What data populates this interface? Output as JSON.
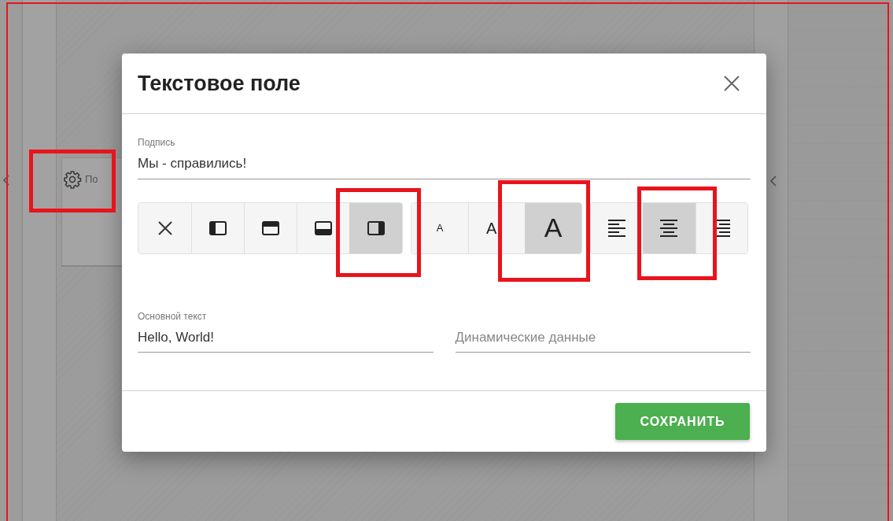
{
  "background": {
    "panel_item": {
      "label": "По"
    }
  },
  "dialog": {
    "title": "Текстовое поле",
    "caption_field": {
      "label": "Подпись",
      "value": "Мы - справились!"
    },
    "toolbar": [
      {
        "kind": "position",
        "buttons": [
          {
            "kind": "none",
            "selected": false
          },
          {
            "kind": "left",
            "selected": false
          },
          {
            "kind": "top",
            "selected": false
          },
          {
            "kind": "bottom",
            "selected": false
          },
          {
            "kind": "right",
            "selected": true
          }
        ]
      },
      {
        "kind": "size",
        "buttons": [
          {
            "kind": "small",
            "label": "A",
            "selected": false
          },
          {
            "kind": "medium",
            "label": "A",
            "selected": false
          },
          {
            "kind": "large",
            "label": "A",
            "selected": true
          }
        ]
      },
      {
        "kind": "align",
        "buttons": [
          {
            "kind": "left",
            "selected": false
          },
          {
            "kind": "center",
            "selected": true
          },
          {
            "kind": "right",
            "selected": false
          }
        ]
      }
    ],
    "main_text_field": {
      "label": "Основной текст",
      "value": "Hello, World!"
    },
    "dynamic_data_field": {
      "placeholder": "Динамические данные"
    },
    "save_button": "СОХРАНИТЬ"
  }
}
